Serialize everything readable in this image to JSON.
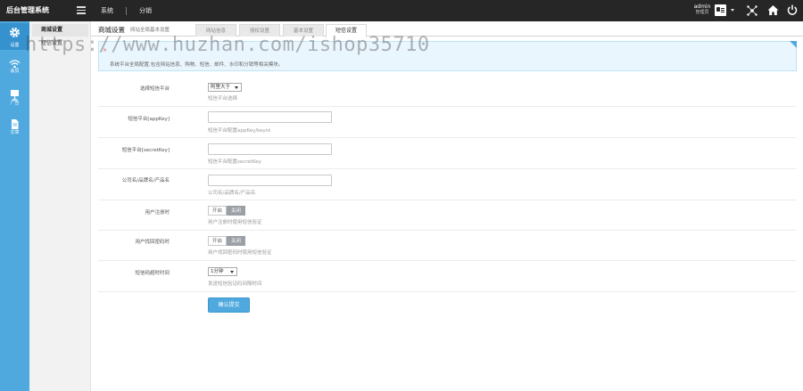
{
  "header": {
    "brand": "后台管理系统",
    "nav": [
      "系统",
      "分销"
    ],
    "admin_name": "admin",
    "admin_role": "管理员"
  },
  "sidebar": {
    "items": [
      {
        "label": "设置",
        "icon": "gear-icon",
        "active": true
      },
      {
        "label": "会员",
        "icon": "wifi-icon",
        "active": false
      },
      {
        "label": "广告",
        "icon": "board-icon",
        "active": false
      },
      {
        "label": "文章",
        "icon": "document-icon",
        "active": false
      }
    ]
  },
  "submenu": {
    "items": [
      "商城设置",
      "短信设置"
    ]
  },
  "tabbar": {
    "title": "商城设置",
    "description": "网站全局基本设置",
    "tabs": [
      "网站信息",
      "授权设置",
      "基本设置",
      "短信设置"
    ]
  },
  "info": {
    "heading": "×",
    "text": "系统平台全局配置,包含网站信息、购物、短信、邮件、水印和分销等相关模块。"
  },
  "form": {
    "rows": [
      {
        "label": "选择短信平台",
        "type": "select",
        "value": "阿里大于",
        "help": "短信平台选择"
      },
      {
        "label": "短信平台[appKey]",
        "type": "input",
        "value": "",
        "help": "短信平台配置appKey/keyid"
      },
      {
        "label": "短信平台[secretKey]",
        "type": "input",
        "value": "",
        "help": "短信平台配置secretKey"
      },
      {
        "label": "公司名/品牌名/产品名",
        "type": "input",
        "value": "",
        "help": "公司名/品牌名/产品名"
      },
      {
        "label": "用户注册时",
        "type": "toggle",
        "on": "开启",
        "off": "关闭",
        "help": "用户注册时使用短信验证"
      },
      {
        "label": "用户找回密码时",
        "type": "toggle",
        "on": "开启",
        "off": "关闭",
        "help": "用户找回密码时使用短信验证"
      },
      {
        "label": "短信码超时时间",
        "type": "select",
        "value": "1分钟",
        "help": "发送短信验证码间隔时间"
      }
    ],
    "submit_label": "确认提交"
  },
  "watermark": "https://www.huzhan.com/ishop35710",
  "colors": {
    "topbar": "#262626",
    "sidebar": "#4fa9df",
    "accent": "#4fa9df",
    "info_bg": "#eaf6fd"
  }
}
